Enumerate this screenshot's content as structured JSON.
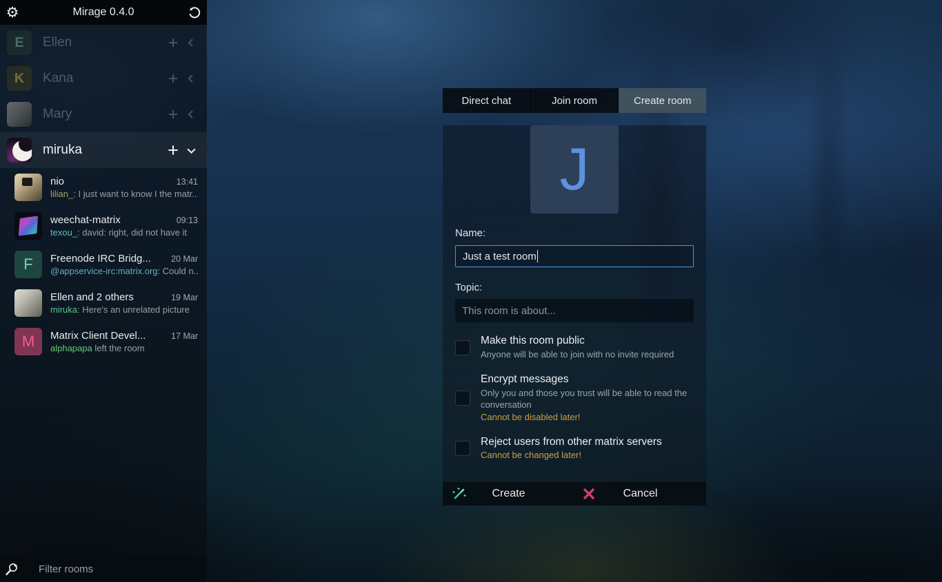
{
  "app": {
    "title": "Mirage 0.4.0"
  },
  "sidebar": {
    "filter_placeholder": "Filter rooms",
    "accounts": [
      {
        "name": "Ellen",
        "initial": "E",
        "avatar_bg": "#21382f",
        "avatar_fg": "#7fae9d",
        "state": "collapsed"
      },
      {
        "name": "Kana",
        "initial": "K",
        "avatar_bg": "#3b3820",
        "avatar_fg": "#c4ad50",
        "state": "collapsed"
      },
      {
        "name": "Mary",
        "initial": "",
        "state": "collapsed"
      },
      {
        "name": "miruka",
        "initial": "",
        "state": "expanded"
      }
    ],
    "rooms": [
      {
        "name": "nio",
        "time": "13:41",
        "sender": "lilian_",
        "message": ": I just want to know I the matr...",
        "sender_color": "#a9a469"
      },
      {
        "name": "weechat-matrix",
        "time": "09:13",
        "sender": "texou_",
        "message": ": david: right, did not have it",
        "sender_color": "#5fbdbd"
      },
      {
        "name": "Freenode IRC Bridg...",
        "time": "20 Mar",
        "sender": "@appservice-irc:matrix.org",
        "message": ": Could n...",
        "sender_color": "#66aec6",
        "initial": "F",
        "avatar_bg": "#1f4540",
        "avatar_fg": "#7bd2bd"
      },
      {
        "name": "Ellen and 2 others",
        "time": "19 Mar",
        "sender": "miruka",
        "message": ": Here's an unrelated picture",
        "sender_color": "#58c289"
      },
      {
        "name": "Matrix Client Devel...",
        "time": "17 Mar",
        "sender": "alphapapa",
        "message": " left the room",
        "sender_color": "#6fc37e",
        "initial": "M",
        "avatar_bg": "#823552",
        "avatar_fg": "#ef5f8f"
      }
    ]
  },
  "dialog": {
    "tabs": [
      {
        "label": "Direct chat"
      },
      {
        "label": "Join room"
      },
      {
        "label": "Create room"
      }
    ],
    "selected_tab": "Create room",
    "avatar_letter": "J",
    "name_label": "Name:",
    "name_value": "Just a test room",
    "topic_label": "Topic:",
    "topic_placeholder": "This room is about...",
    "checkboxes": [
      {
        "title": "Make this room public",
        "subtitle": "Anyone will be able to join with no invite required",
        "checked": false
      },
      {
        "title": "Encrypt messages",
        "subtitle": "Only you and those you trust will be able to read the conversation",
        "warning": "Cannot be disabled later!",
        "checked": false
      },
      {
        "title": "Reject users from other matrix servers",
        "warning": "Cannot be changed later!",
        "checked": false
      }
    ],
    "create_label": "Create",
    "cancel_label": "Cancel"
  },
  "colors": {
    "accent_blue": "#4a9ad8",
    "warning_orange": "#cf9f3e",
    "cancel_red": "#d63a6a",
    "wand_teal": "#35c8a8",
    "avatar_letter_blue": "#5c92e0"
  }
}
